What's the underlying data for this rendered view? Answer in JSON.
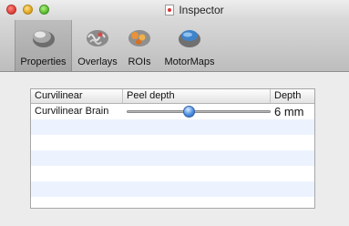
{
  "window": {
    "title": "Inspector"
  },
  "toolbar": {
    "items": [
      {
        "label": "Properties",
        "icon": "brain-properties-icon",
        "selected": true
      },
      {
        "label": "Overlays",
        "icon": "brain-overlays-icon",
        "selected": false
      },
      {
        "label": "ROIs",
        "icon": "brain-rois-icon",
        "selected": false
      },
      {
        "label": "MotorMaps",
        "icon": "brain-motormaps-icon",
        "selected": false
      }
    ]
  },
  "table": {
    "columns": [
      "Curvilinear",
      "Peel depth",
      "Depth"
    ],
    "rows": [
      {
        "name": "Curvilinear Brain",
        "peel_depth_fraction": 0.43,
        "depth": "6 mm"
      }
    ]
  },
  "colors": {
    "selection_accent": "#4d8fe0",
    "alt_row": "#edf3fe"
  }
}
